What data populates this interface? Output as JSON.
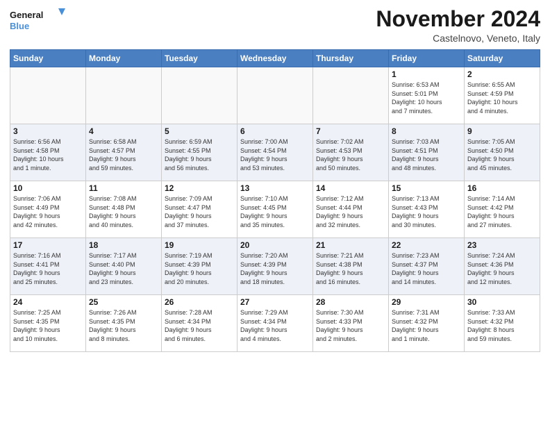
{
  "logo": {
    "line1": "General",
    "line2": "Blue"
  },
  "title": "November 2024",
  "subtitle": "Castelnovo, Veneto, Italy",
  "weekdays": [
    "Sunday",
    "Monday",
    "Tuesday",
    "Wednesday",
    "Thursday",
    "Friday",
    "Saturday"
  ],
  "weeks": [
    [
      {
        "day": "",
        "info": ""
      },
      {
        "day": "",
        "info": ""
      },
      {
        "day": "",
        "info": ""
      },
      {
        "day": "",
        "info": ""
      },
      {
        "day": "",
        "info": ""
      },
      {
        "day": "1",
        "info": "Sunrise: 6:53 AM\nSunset: 5:01 PM\nDaylight: 10 hours\nand 7 minutes."
      },
      {
        "day": "2",
        "info": "Sunrise: 6:55 AM\nSunset: 4:59 PM\nDaylight: 10 hours\nand 4 minutes."
      }
    ],
    [
      {
        "day": "3",
        "info": "Sunrise: 6:56 AM\nSunset: 4:58 PM\nDaylight: 10 hours\nand 1 minute."
      },
      {
        "day": "4",
        "info": "Sunrise: 6:58 AM\nSunset: 4:57 PM\nDaylight: 9 hours\nand 59 minutes."
      },
      {
        "day": "5",
        "info": "Sunrise: 6:59 AM\nSunset: 4:55 PM\nDaylight: 9 hours\nand 56 minutes."
      },
      {
        "day": "6",
        "info": "Sunrise: 7:00 AM\nSunset: 4:54 PM\nDaylight: 9 hours\nand 53 minutes."
      },
      {
        "day": "7",
        "info": "Sunrise: 7:02 AM\nSunset: 4:53 PM\nDaylight: 9 hours\nand 50 minutes."
      },
      {
        "day": "8",
        "info": "Sunrise: 7:03 AM\nSunset: 4:51 PM\nDaylight: 9 hours\nand 48 minutes."
      },
      {
        "day": "9",
        "info": "Sunrise: 7:05 AM\nSunset: 4:50 PM\nDaylight: 9 hours\nand 45 minutes."
      }
    ],
    [
      {
        "day": "10",
        "info": "Sunrise: 7:06 AM\nSunset: 4:49 PM\nDaylight: 9 hours\nand 42 minutes."
      },
      {
        "day": "11",
        "info": "Sunrise: 7:08 AM\nSunset: 4:48 PM\nDaylight: 9 hours\nand 40 minutes."
      },
      {
        "day": "12",
        "info": "Sunrise: 7:09 AM\nSunset: 4:47 PM\nDaylight: 9 hours\nand 37 minutes."
      },
      {
        "day": "13",
        "info": "Sunrise: 7:10 AM\nSunset: 4:45 PM\nDaylight: 9 hours\nand 35 minutes."
      },
      {
        "day": "14",
        "info": "Sunrise: 7:12 AM\nSunset: 4:44 PM\nDaylight: 9 hours\nand 32 minutes."
      },
      {
        "day": "15",
        "info": "Sunrise: 7:13 AM\nSunset: 4:43 PM\nDaylight: 9 hours\nand 30 minutes."
      },
      {
        "day": "16",
        "info": "Sunrise: 7:14 AM\nSunset: 4:42 PM\nDaylight: 9 hours\nand 27 minutes."
      }
    ],
    [
      {
        "day": "17",
        "info": "Sunrise: 7:16 AM\nSunset: 4:41 PM\nDaylight: 9 hours\nand 25 minutes."
      },
      {
        "day": "18",
        "info": "Sunrise: 7:17 AM\nSunset: 4:40 PM\nDaylight: 9 hours\nand 23 minutes."
      },
      {
        "day": "19",
        "info": "Sunrise: 7:19 AM\nSunset: 4:39 PM\nDaylight: 9 hours\nand 20 minutes."
      },
      {
        "day": "20",
        "info": "Sunrise: 7:20 AM\nSunset: 4:39 PM\nDaylight: 9 hours\nand 18 minutes."
      },
      {
        "day": "21",
        "info": "Sunrise: 7:21 AM\nSunset: 4:38 PM\nDaylight: 9 hours\nand 16 minutes."
      },
      {
        "day": "22",
        "info": "Sunrise: 7:23 AM\nSunset: 4:37 PM\nDaylight: 9 hours\nand 14 minutes."
      },
      {
        "day": "23",
        "info": "Sunrise: 7:24 AM\nSunset: 4:36 PM\nDaylight: 9 hours\nand 12 minutes."
      }
    ],
    [
      {
        "day": "24",
        "info": "Sunrise: 7:25 AM\nSunset: 4:35 PM\nDaylight: 9 hours\nand 10 minutes."
      },
      {
        "day": "25",
        "info": "Sunrise: 7:26 AM\nSunset: 4:35 PM\nDaylight: 9 hours\nand 8 minutes."
      },
      {
        "day": "26",
        "info": "Sunrise: 7:28 AM\nSunset: 4:34 PM\nDaylight: 9 hours\nand 6 minutes."
      },
      {
        "day": "27",
        "info": "Sunrise: 7:29 AM\nSunset: 4:34 PM\nDaylight: 9 hours\nand 4 minutes."
      },
      {
        "day": "28",
        "info": "Sunrise: 7:30 AM\nSunset: 4:33 PM\nDaylight: 9 hours\nand 2 minutes."
      },
      {
        "day": "29",
        "info": "Sunrise: 7:31 AM\nSunset: 4:32 PM\nDaylight: 9 hours\nand 1 minute."
      },
      {
        "day": "30",
        "info": "Sunrise: 7:33 AM\nSunset: 4:32 PM\nDaylight: 8 hours\nand 59 minutes."
      }
    ]
  ]
}
